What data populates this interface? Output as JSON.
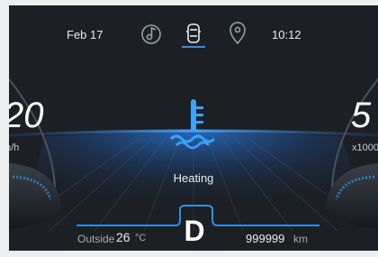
{
  "status_bar": {
    "date": "Feb 17",
    "time": "10:12",
    "tabs": [
      {
        "icon": "music-note-icon",
        "active": false
      },
      {
        "icon": "car-icon",
        "active": true
      },
      {
        "icon": "location-pin-icon",
        "active": false
      }
    ]
  },
  "left_gauge": {
    "value": "20",
    "unit": "n/h"
  },
  "right_gauge": {
    "value": "5",
    "unit": "x1000"
  },
  "center": {
    "warning_icon": "coolant-temperature-icon",
    "status_text": "Heating",
    "gear": "D"
  },
  "footer": {
    "outside_label": "Outside",
    "outside_temp": "26",
    "outside_unit": "°C",
    "odometer": "999999",
    "odometer_unit": "km"
  },
  "colors": {
    "background": "#1c1f24",
    "accent": "#2f8fe6",
    "text": "#e9edf2",
    "muted": "#a5abb2"
  }
}
